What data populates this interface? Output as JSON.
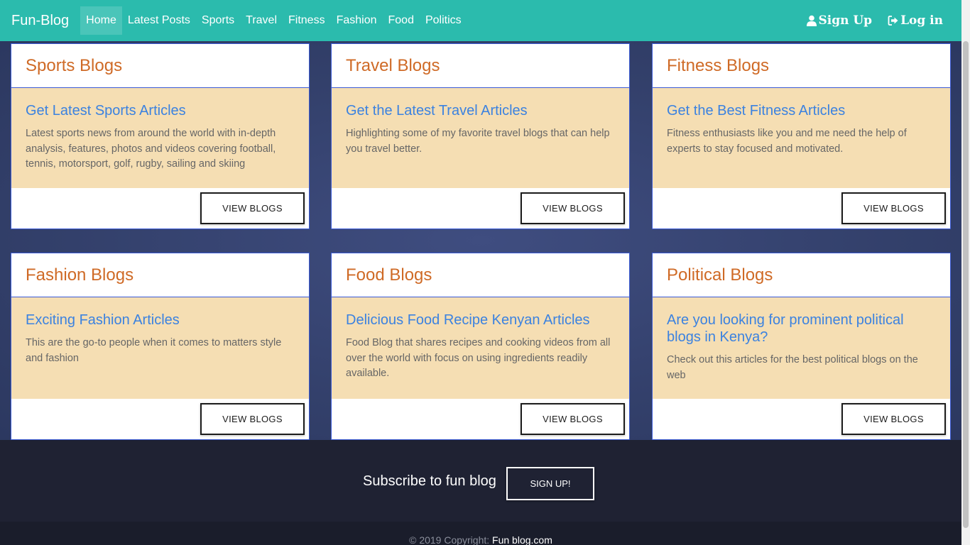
{
  "navbar": {
    "brand": "Fun-Blog",
    "links": [
      "Home",
      "Latest Posts",
      "Sports",
      "Travel",
      "Fitness",
      "Fashion",
      "Food",
      "Politics"
    ],
    "signup": "Sign Up",
    "login": "Log in",
    "background": "#2bbbad"
  },
  "cards": [
    {
      "title": "Sports Blogs",
      "heading": "Get Latest Sports Articles",
      "text": "Latest sports news from around the world with in-depth analysis, features, photos and videos covering football, tennis, motorsport, golf, rugby, sailing and skiing",
      "button": "VIEW BLOGS"
    },
    {
      "title": "Travel Blogs",
      "heading": "Get the Latest Travel Articles",
      "text": "Highlighting some of my favorite travel blogs that can help you travel better.",
      "button": "VIEW BLOGS"
    },
    {
      "title": "Fitness Blogs",
      "heading": "Get the Best Fitness Articles",
      "text": "Fitness enthusiasts like you and me need the help of experts to stay focused and motivated.",
      "button": "VIEW BLOGS"
    },
    {
      "title": "Fashion Blogs",
      "heading": "Exciting Fashion Articles",
      "text": "This are the go-to people when it comes to matters style and fashion",
      "button": "VIEW BLOGS"
    },
    {
      "title": "Food Blogs",
      "heading": "Delicious Food Recipe Kenyan Articles",
      "text": "Food Blog that shares recipes and cooking videos from all over the world with focus on using ingredients readily available.",
      "button": "VIEW BLOGS"
    },
    {
      "title": "Political Blogs",
      "heading": "Are you looking for prominent political blogs in Kenya?",
      "text": "Check out this articles for the best political blogs on the web",
      "button": "VIEW BLOGS"
    }
  ],
  "subscribe": {
    "text": "Subscribe to fun blog",
    "button": "SIGN UP!"
  },
  "footer": {
    "copyright": "© 2019 Copyright:",
    "link": "Fun blog.com"
  },
  "colors": {
    "card_title": "#cf6a26",
    "card_heading": "#3b82e0",
    "card_body_bg": "#f5deb3",
    "page_bg": "#33406b",
    "subscribe_bg": "#1f2233"
  }
}
